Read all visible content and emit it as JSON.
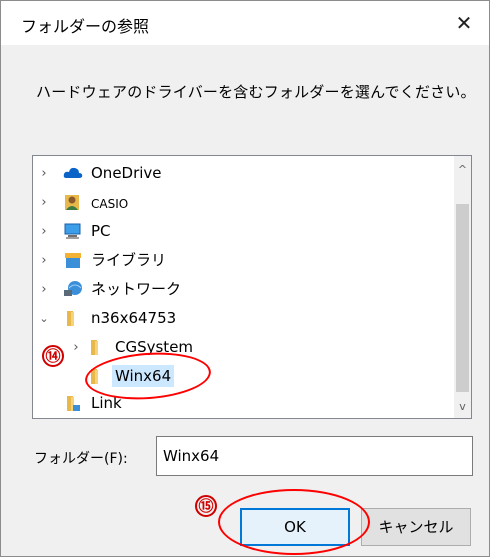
{
  "dialog": {
    "title": "フォルダーの参照",
    "close_glyph": "✕",
    "instruction": "ハードウェアのドライバーを含むフォルダーを選んでください。"
  },
  "tree": {
    "items": [
      {
        "label": "OneDrive",
        "icon": "cloud-icon",
        "expander": "chevron-right-icon"
      },
      {
        "label": "CASIO",
        "icon": "user-icon",
        "expander": "chevron-right-icon"
      },
      {
        "label": "PC",
        "icon": "computer-icon",
        "expander": "chevron-right-icon"
      },
      {
        "label": "ライブラリ",
        "icon": "library-icon",
        "expander": "chevron-right-icon"
      },
      {
        "label": "ネットワーク",
        "icon": "network-icon",
        "expander": "chevron-right-icon"
      },
      {
        "label": "n36x64753",
        "icon": "folder-icon",
        "expander": "chevron-down-icon"
      },
      {
        "label": "CGSystem",
        "icon": "folder-icon",
        "expander": "chevron-right-icon"
      },
      {
        "label": "Winx64",
        "icon": "folder-icon",
        "expander": "",
        "selected": true
      },
      {
        "label": "Link",
        "icon": "folder-link-icon",
        "expander": ""
      }
    ],
    "scroll_up_glyph": "^",
    "scroll_down_glyph": "v"
  },
  "folder": {
    "label": "フォルダー(F):",
    "value": "Winx64"
  },
  "buttons": {
    "ok": "OK",
    "cancel": "キャンセル"
  },
  "annotations": {
    "step14": "⑭",
    "step15": "⑮",
    "color": "#ff0000"
  },
  "colors": {
    "selection": "#cce8ff",
    "focus_border": "#0078d7",
    "dialog_bg": "#f0f0f0"
  }
}
